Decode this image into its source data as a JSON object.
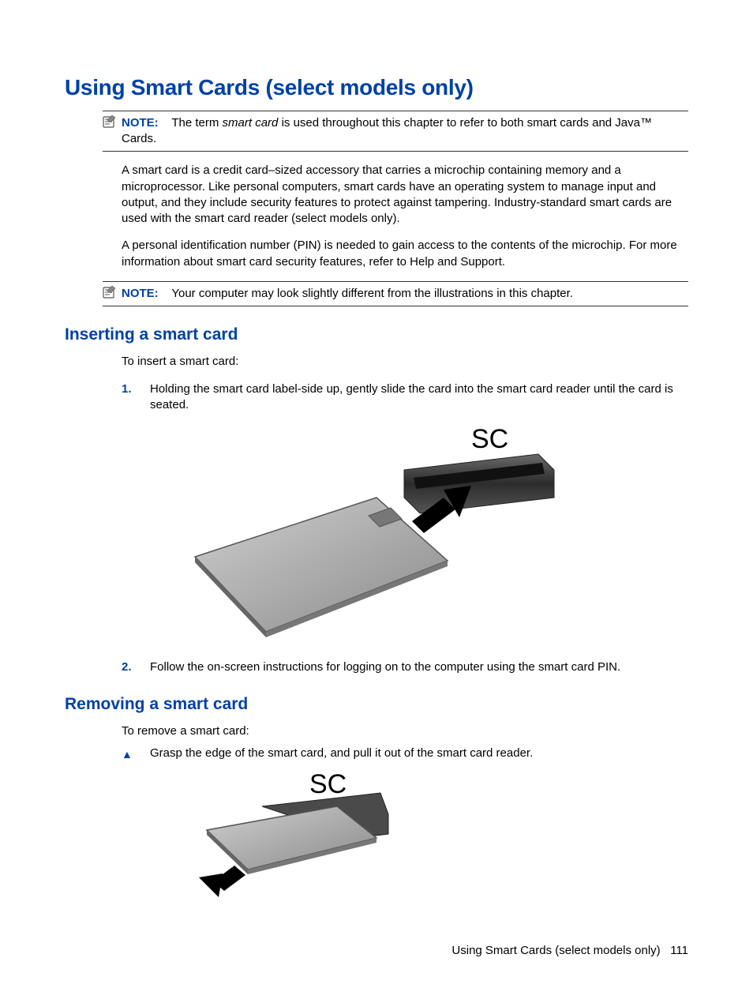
{
  "h1": "Using Smart Cards (select models only)",
  "note1": {
    "label": "NOTE:",
    "pre": "The term ",
    "em": "smart card",
    "post": " is used throughout this chapter to refer to both smart cards and Java™ Cards."
  },
  "para1": "A smart card is a credit card–sized accessory that carries a microchip containing memory and a microprocessor. Like personal computers, smart cards have an operating system to manage input and output, and they include security features to protect against tampering. Industry-standard smart cards are used with the smart card reader (select models only).",
  "para2": "A personal identification number (PIN) is needed to gain access to the contents of the microchip. For more information about smart card security features, refer to Help and Support.",
  "note2": {
    "label": "NOTE:",
    "text": "Your computer may look slightly different from the illustrations in this chapter."
  },
  "section_insert": {
    "heading": "Inserting a smart card",
    "intro": "To insert a smart card:",
    "step1_num": "1.",
    "step1": "Holding the smart card label-side up, gently slide the card into the smart card reader until the card is seated.",
    "fig_label": "SC",
    "step2_num": "2.",
    "step2": "Follow the on-screen instructions for logging on to the computer using the smart card PIN."
  },
  "section_remove": {
    "heading": "Removing a smart card",
    "intro": "To remove a smart card:",
    "bullet_mark": "▲",
    "bullet": "Grasp the edge of the smart card, and pull it out of the smart card reader.",
    "fig_label": "SC"
  },
  "footer": {
    "text": "Using Smart Cards (select models only)",
    "page": "111"
  }
}
